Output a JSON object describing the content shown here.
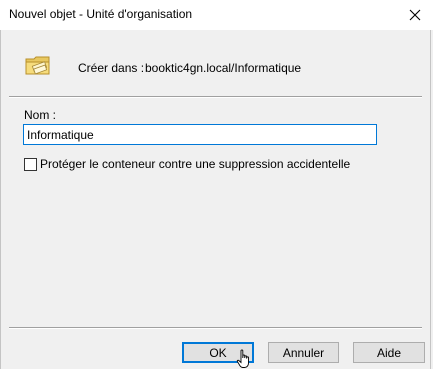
{
  "window": {
    "title": "Nouvel objet - Unité d'organisation",
    "close_icon": "close-icon"
  },
  "header": {
    "icon": "organizational-unit-icon",
    "create_in_label": "Créer dans :",
    "create_in_path": "booktic4gn.local/Informatique"
  },
  "form": {
    "name_label": "Nom :",
    "name_value": "Informatique",
    "protect_checkbox_label": "Protéger le conteneur contre une suppression accidentelle",
    "protect_checked": false
  },
  "buttons": {
    "ok": "OK",
    "cancel": "Annuler",
    "help": "Aide"
  },
  "colors": {
    "focus_accent": "#0078d7",
    "dialog_background": "#f0f0f0"
  }
}
